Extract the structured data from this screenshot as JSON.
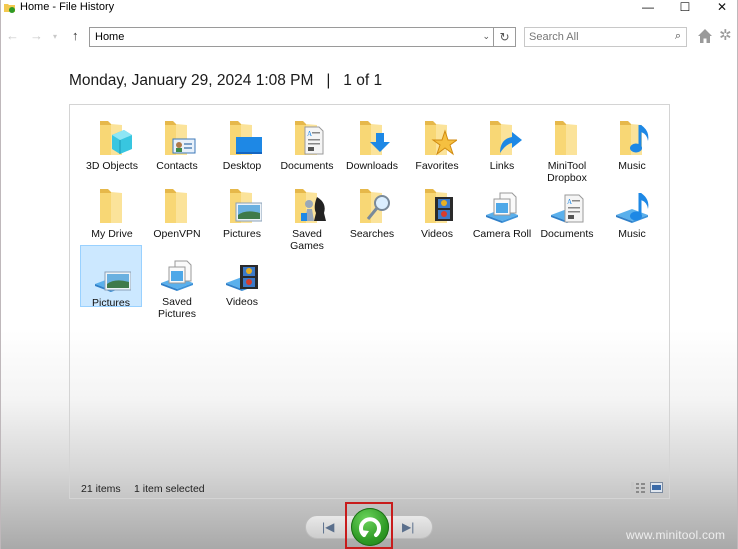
{
  "window": {
    "title": "Home - File History",
    "minimize_glyph": "—",
    "maximize_glyph": "☐",
    "close_glyph": "✕"
  },
  "nav": {
    "back_glyph": "←",
    "forward_glyph": "→",
    "recent_glyph": "▾",
    "up_glyph": "↑",
    "address_value": "Home",
    "address_dropdown_glyph": "⌄",
    "refresh_glyph": "↻",
    "search_placeholder": "Search All",
    "search_glyph": "⌕",
    "settings_glyph": "✲"
  },
  "snapshot": {
    "date": "Monday, January 29, 2024 1:08 PM",
    "separator": "|",
    "position": "1 of 1"
  },
  "items": [
    {
      "label": "3D Objects",
      "icon": "folder-3d-objects-icon",
      "kind": "folder",
      "overlay": "cube"
    },
    {
      "label": "Contacts",
      "icon": "folder-contacts-icon",
      "kind": "folder",
      "overlay": "contact"
    },
    {
      "label": "Desktop",
      "icon": "folder-desktop-icon",
      "kind": "folder",
      "overlay": "desktop"
    },
    {
      "label": "Documents",
      "icon": "folder-documents-icon",
      "kind": "folder",
      "overlay": "doc"
    },
    {
      "label": "Downloads",
      "icon": "folder-downloads-icon",
      "kind": "folder",
      "overlay": "download"
    },
    {
      "label": "Favorites",
      "icon": "folder-favorites-icon",
      "kind": "folder",
      "overlay": "star"
    },
    {
      "label": "Links",
      "icon": "folder-links-icon",
      "kind": "folder",
      "overlay": "link"
    },
    {
      "label": "MiniTool Dropbox",
      "icon": "folder-icon",
      "kind": "folder",
      "overlay": "none"
    },
    {
      "label": "Music",
      "icon": "folder-music-icon",
      "kind": "folder",
      "overlay": "music"
    },
    {
      "label": "My Drive",
      "icon": "folder-icon",
      "kind": "folder",
      "overlay": "none"
    },
    {
      "label": "OpenVPN",
      "icon": "folder-icon",
      "kind": "folder",
      "overlay": "none"
    },
    {
      "label": "Pictures",
      "icon": "folder-pictures-icon",
      "kind": "folder",
      "overlay": "picture"
    },
    {
      "label": "Saved Games",
      "icon": "folder-saved-games-icon",
      "kind": "folder",
      "overlay": "chess"
    },
    {
      "label": "Searches",
      "icon": "folder-searches-icon",
      "kind": "folder",
      "overlay": "search"
    },
    {
      "label": "Videos",
      "icon": "folder-videos-icon",
      "kind": "folder",
      "overlay": "film"
    },
    {
      "label": "Camera Roll",
      "icon": "library-camera-roll-icon",
      "kind": "library",
      "overlay": "pages"
    },
    {
      "label": "Documents",
      "icon": "library-documents-icon",
      "kind": "library",
      "overlay": "doc"
    },
    {
      "label": "Music",
      "icon": "library-music-icon",
      "kind": "library",
      "overlay": "music"
    },
    {
      "label": "Pictures",
      "icon": "library-pictures-icon",
      "kind": "library",
      "overlay": "picture",
      "selected": true
    },
    {
      "label": "Saved Pictures",
      "icon": "library-saved-pictures-icon",
      "kind": "library",
      "overlay": "pages"
    },
    {
      "label": "Videos",
      "icon": "library-videos-icon",
      "kind": "library",
      "overlay": "film"
    }
  ],
  "status": {
    "count": "21 items",
    "selection": "1 item selected"
  },
  "playback": {
    "previous_glyph": "|◀",
    "next_glyph": "▶|"
  },
  "watermark": "www.minitool.com",
  "colors": {
    "folder": "#f8d775",
    "folder_dark": "#e6b84a",
    "accent_blue": "#1e88e5",
    "selection": "#cce8ff",
    "restore_green": "#2e9a25",
    "highlight_red": "#c81c1c"
  }
}
